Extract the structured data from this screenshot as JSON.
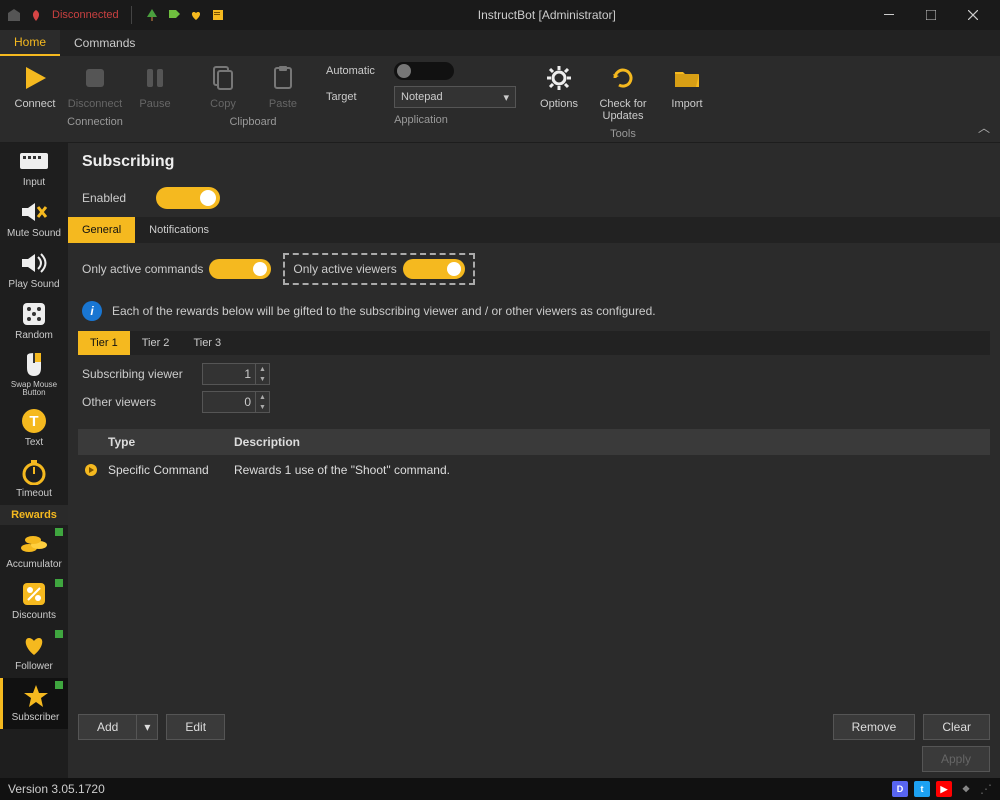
{
  "titlebar": {
    "status": "Disconnected",
    "title": "InstructBot [Administrator]"
  },
  "menu": {
    "home": "Home",
    "commands": "Commands"
  },
  "ribbon": {
    "connect": "Connect",
    "disconnect": "Disconnect",
    "pause": "Pause",
    "copy": "Copy",
    "paste": "Paste",
    "automatic_label": "Automatic",
    "target_label": "Target",
    "target_value": "Notepad",
    "options": "Options",
    "check_updates": "Check for Updates",
    "import": "Import",
    "group_connection": "Connection",
    "group_clipboard": "Clipboard",
    "group_application": "Application",
    "group_tools": "Tools"
  },
  "sidebar": {
    "input": "Input",
    "mute_sound": "Mute Sound",
    "play_sound": "Play Sound",
    "random": "Random",
    "swap_mouse": "Swap Mouse Button",
    "text": "Text",
    "timeout": "Timeout",
    "rewards_header": "Rewards",
    "accumulator": "Accumulator",
    "discounts": "Discounts",
    "follower": "Follower",
    "subscriber": "Subscriber"
  },
  "page": {
    "title": "Subscribing",
    "enabled_label": "Enabled",
    "tabs": {
      "general": "General",
      "notifications": "Notifications"
    },
    "only_active_commands": "Only active commands",
    "only_active_viewers": "Only active viewers",
    "info": "Each of the rewards below will be gifted to the subscribing viewer and / or other viewers as configured.",
    "tiers": {
      "t1": "Tier 1",
      "t2": "Tier 2",
      "t3": "Tier 3"
    },
    "subscribing_viewer_label": "Subscribing viewer",
    "subscribing_viewer_value": "1",
    "other_viewers_label": "Other viewers",
    "other_viewers_value": "0",
    "table": {
      "type_header": "Type",
      "description_header": "Description",
      "rows": [
        {
          "type": "Specific Command",
          "description": "Rewards 1 use of the \"Shoot\" command."
        }
      ]
    },
    "buttons": {
      "add": "Add",
      "edit": "Edit",
      "remove": "Remove",
      "clear": "Clear",
      "apply": "Apply"
    }
  },
  "statusbar": {
    "version": "Version 3.05.1720"
  }
}
